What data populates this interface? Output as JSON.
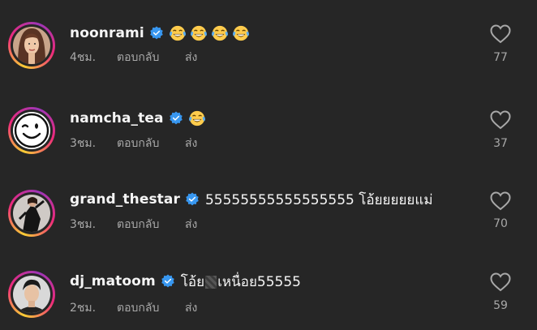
{
  "comments": [
    {
      "username": "noonrami",
      "text": "",
      "emoji": [
        "face-with-tears-of-joy",
        "face-with-tears-of-joy",
        "face-with-tears-of-joy",
        "face-with-tears-of-joy"
      ],
      "time": "4ชม.",
      "reply_label": "ตอบกลับ",
      "send_label": "ส่ง",
      "likes": "77"
    },
    {
      "username": "namcha_tea",
      "text": "",
      "emoji": [
        "face-with-tears-of-joy"
      ],
      "time": "3ชม.",
      "reply_label": "ตอบกลับ",
      "send_label": "ส่ง",
      "likes": "37"
    },
    {
      "username": "grand_thestar",
      "text": "55555555555555555 โอ้ยยยยยแม่",
      "emoji": [],
      "time": "3ชม.",
      "reply_label": "ตอบกลับ",
      "send_label": "ส่ง",
      "likes": "70"
    },
    {
      "username": "dj_matoom",
      "text_before": "โอ้ย",
      "text_after": "เหนื่อย55555",
      "emoji": [],
      "time": "2ชม.",
      "reply_label": "ตอบกลับ",
      "send_label": "ส่ง",
      "likes": "59"
    }
  ],
  "colors": {
    "background": "#262626",
    "primary_text": "#f5f5f5",
    "secondary_text": "#a8a8a8",
    "verified_blue": "#3897f0"
  }
}
